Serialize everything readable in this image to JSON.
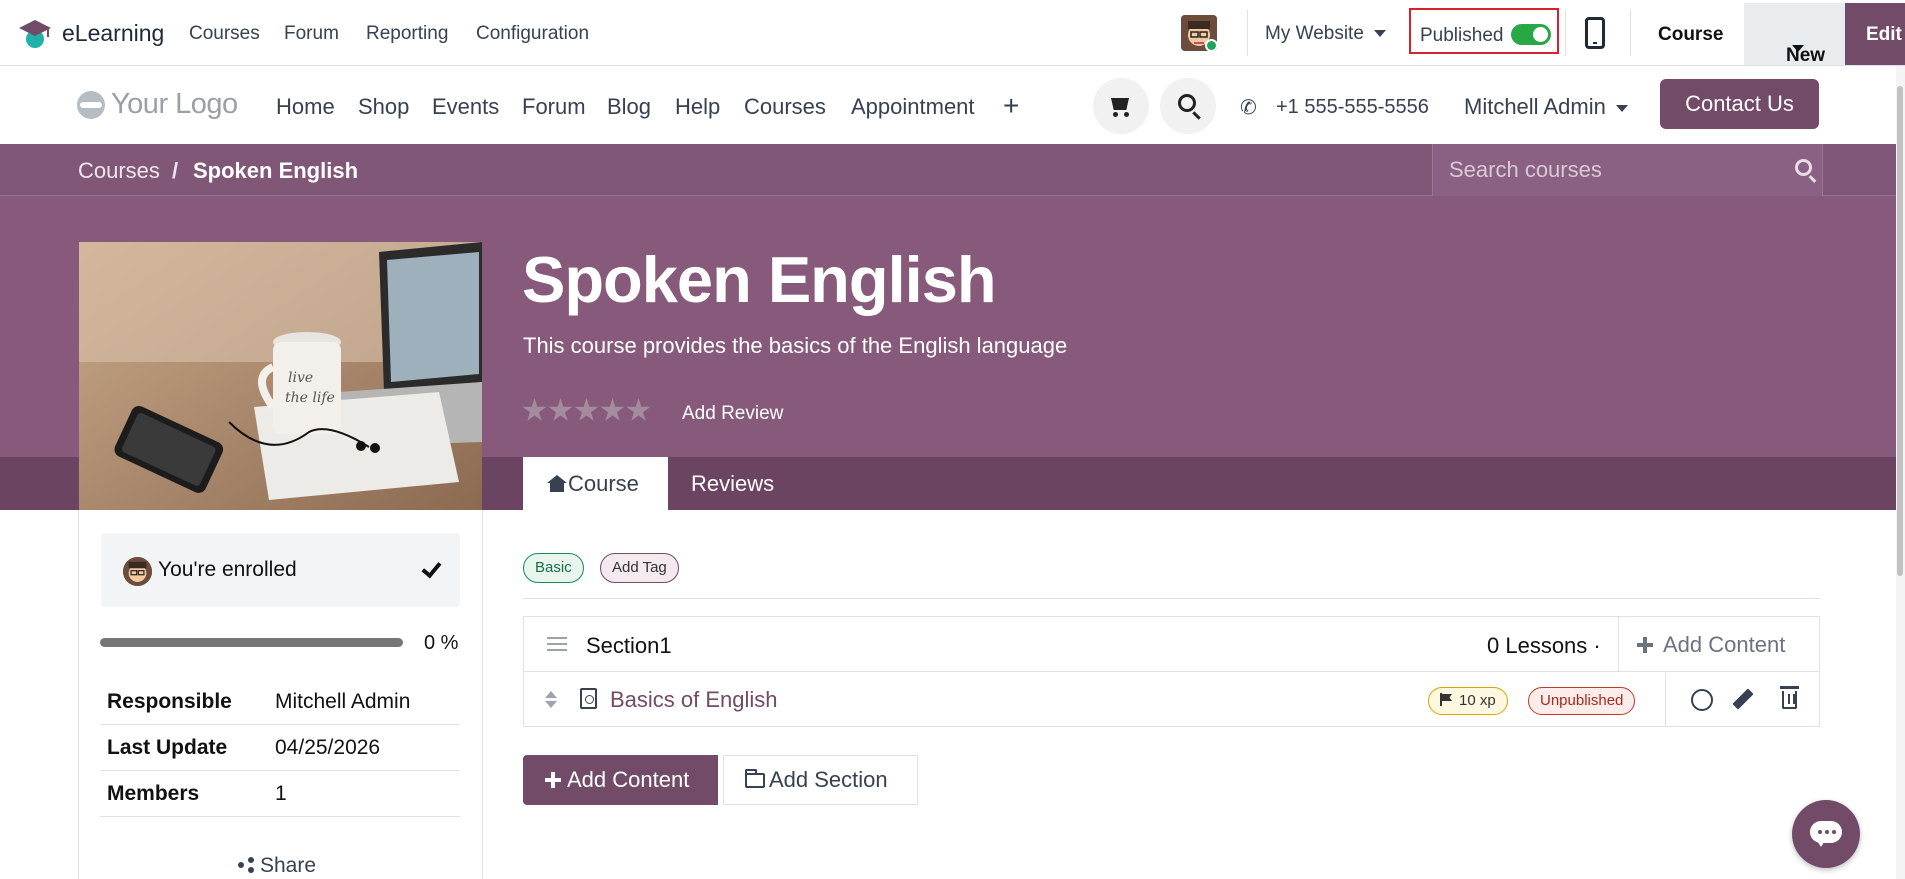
{
  "topbar": {
    "app_name": "eLearning",
    "menu": [
      "Courses",
      "Forum",
      "Reporting",
      "Configuration"
    ],
    "website_selector": "My Website",
    "published_label": "Published",
    "published": true,
    "course_label": "Course",
    "new_label": "New",
    "edit_label": "Edit"
  },
  "site_header": {
    "logo_text": "Your Logo",
    "nav": [
      "Home",
      "Shop",
      "Events",
      "Forum",
      "Blog",
      "Help",
      "Courses",
      "Appointment"
    ],
    "phone": "+1 555-555-5556",
    "user": "Mitchell Admin",
    "contact_label": "Contact Us"
  },
  "breadcrumb": {
    "parent": "Courses",
    "separator": "/",
    "current": "Spoken English"
  },
  "search": {
    "placeholder": "Search courses"
  },
  "course": {
    "title": "Spoken English",
    "description": "This course provides the basics of the English language",
    "rating": 0,
    "add_review_label": "Add Review",
    "tabs": [
      "Course",
      "Reviews"
    ]
  },
  "sidebar": {
    "enrolled_label": "You're enrolled",
    "progress_percent": 0,
    "progress_text": "0 %",
    "info": [
      {
        "key": "Responsible",
        "value": "Mitchell Admin"
      },
      {
        "key": "Last Update",
        "value": "04/25/2026"
      },
      {
        "key": "Members",
        "value": "1"
      }
    ],
    "share_label": "Share"
  },
  "tags": [
    "Basic",
    "Add Tag"
  ],
  "section": {
    "name": "Section1",
    "lessons_text": "0 Lessons ·",
    "add_content_label": "Add Content",
    "lesson": {
      "name": "Basics of English",
      "xp": "10 xp",
      "status": "Unpublished"
    }
  },
  "actions": {
    "add_content": "Add Content",
    "add_section": "Add Section"
  },
  "colors": {
    "brand": "#714b67",
    "banner": "#875a7b",
    "published_toggle": "#28a745",
    "highlight_box": "#d9212b"
  }
}
